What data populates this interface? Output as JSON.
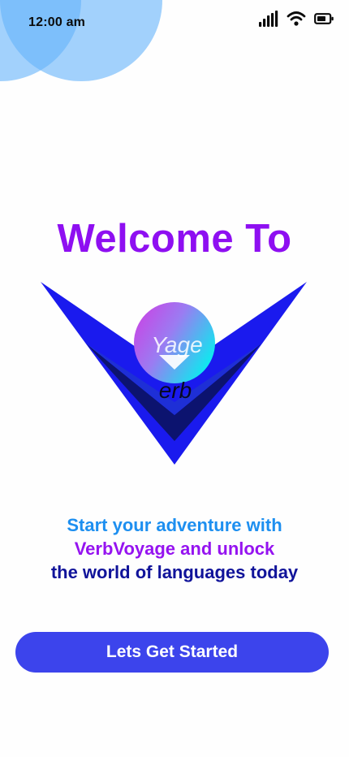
{
  "status_bar": {
    "time": "12:00 am",
    "icons": [
      "signal-icon",
      "wifi-icon",
      "battery-icon"
    ]
  },
  "welcome": {
    "title": "Welcome To"
  },
  "logo": {
    "top_text": "Yage",
    "bottom_text": "erb",
    "colors": {
      "outer_v": "#1a1aee",
      "inner_v": "#1e2fd6",
      "shadow_v": "#0c136f",
      "orb_start": "#c04de8",
      "orb_end": "#18e3f0"
    }
  },
  "tagline": {
    "line1": "Start your adventure with",
    "line2": "VerbVoyage and unlock",
    "line3": "the world of languages today"
  },
  "cta": {
    "label": "Lets Get Started"
  },
  "colors": {
    "title": "#8e0ff1",
    "button": "#3c44ec",
    "decor_circles": "#64b2fa"
  }
}
